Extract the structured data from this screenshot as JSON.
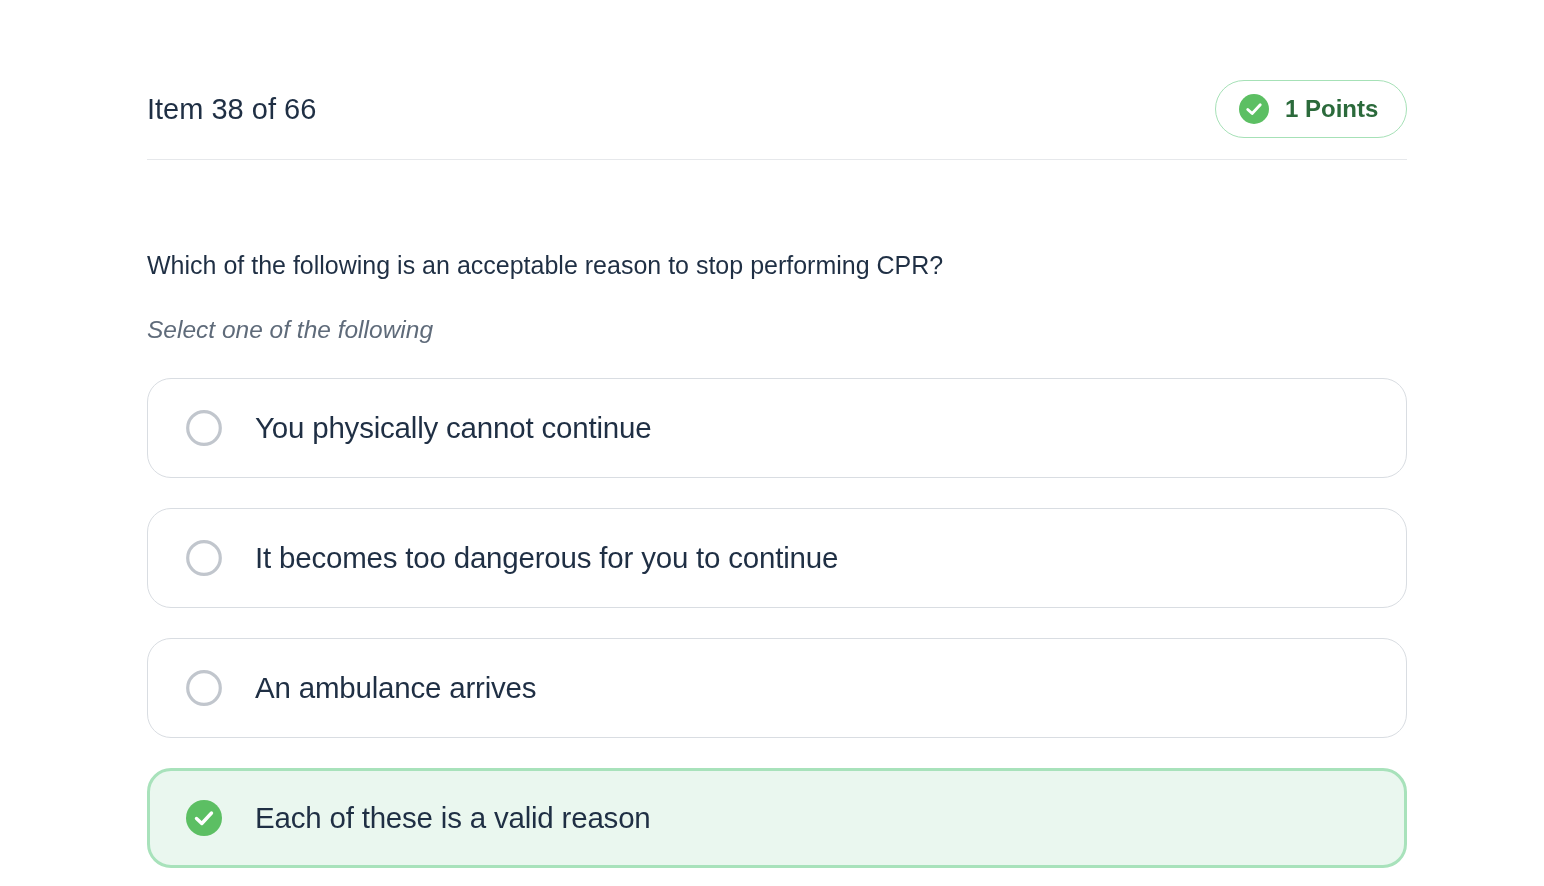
{
  "header": {
    "item_label": "Item 38 of 66",
    "points_badge": {
      "label": "1 Points"
    }
  },
  "question": {
    "text": "Which of the following is an acceptable reason to stop performing CPR?",
    "instruction": "Select one of the following"
  },
  "options": [
    {
      "label": "You physically cannot continue",
      "selected": false
    },
    {
      "label": "It becomes too dangerous for you to continue",
      "selected": false
    },
    {
      "label": "An ambulance arrives",
      "selected": false
    },
    {
      "label": "Each of these is a valid reason",
      "selected": true
    }
  ]
}
